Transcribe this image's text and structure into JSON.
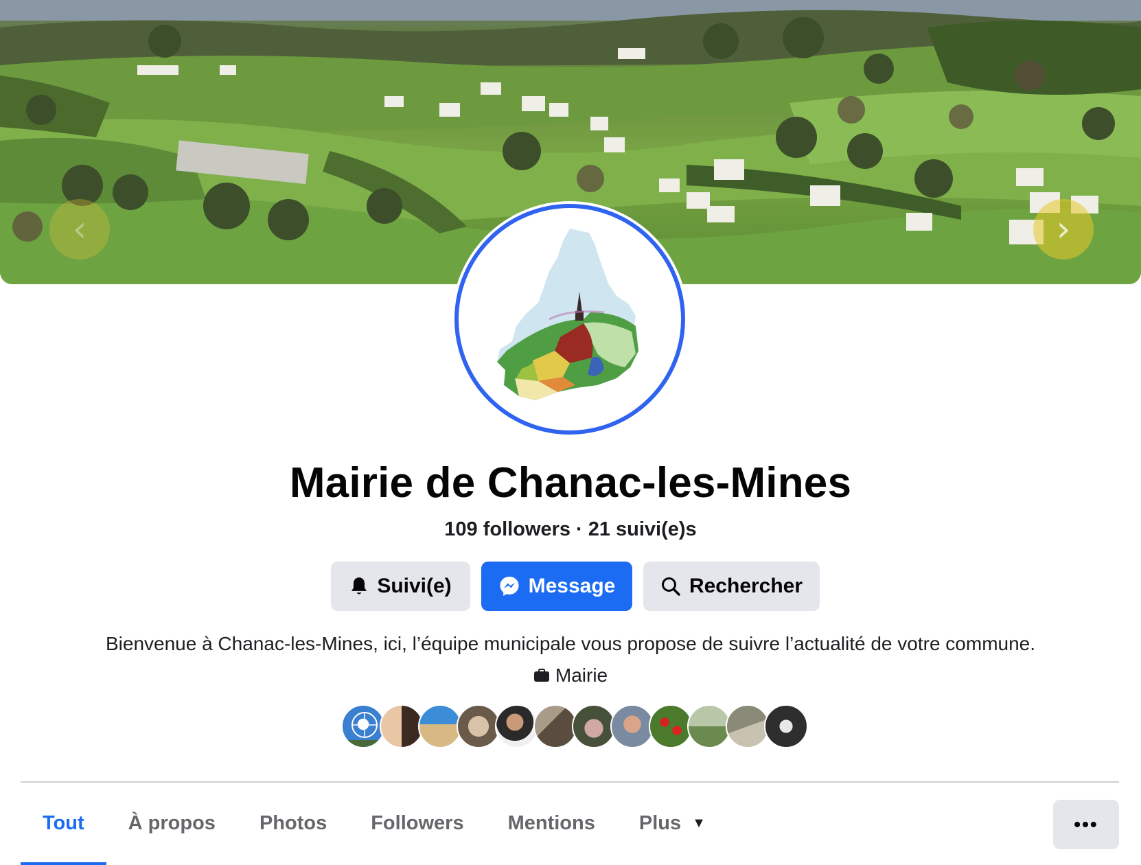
{
  "page": {
    "title": "Mairie de Chanac-les-Mines",
    "followers": "109 followers",
    "separator": "·",
    "following": "21 suivi(e)s",
    "bio": "Bienvenue à Chanac-les-Mines, ici, l’équipe municipale vous propose de suivre l’actualité de votre commune.",
    "category": "Mairie"
  },
  "cover": {
    "prev_icon": "chevron-left-icon",
    "next_icon": "chevron-right-icon",
    "prev_glyph": "‹",
    "next_glyph": "›"
  },
  "actions": {
    "follow_label": "Suivi(e)",
    "message_label": "Message",
    "search_label": "Rechercher"
  },
  "tabs": [
    {
      "label": "Tout",
      "active": true
    },
    {
      "label": "À propos",
      "active": false
    },
    {
      "label": "Photos",
      "active": false
    },
    {
      "label": "Followers",
      "active": false
    },
    {
      "label": "Mentions",
      "active": false
    },
    {
      "label": "Plus",
      "active": false
    }
  ],
  "more_button": "•••",
  "colors": {
    "accent": "#1b6cf2",
    "avatar_ring": "#2f63f0",
    "button_grey": "#e4e6eb",
    "muted_text": "#65676b"
  },
  "follower_faces": 12
}
